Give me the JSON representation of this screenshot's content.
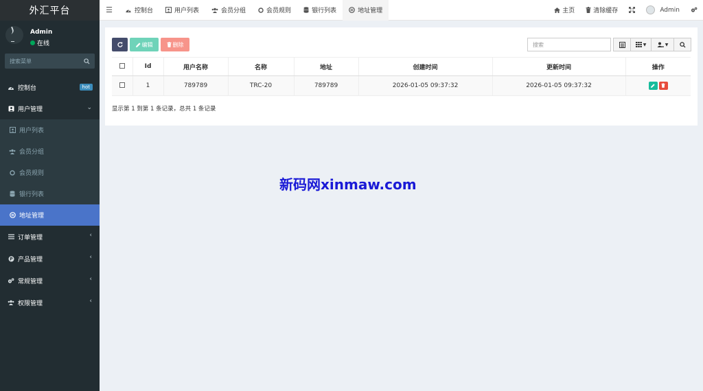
{
  "brand": "外汇平台",
  "user": {
    "name": "Admin",
    "status": "在线"
  },
  "sidebar": {
    "search_placeholder": "搜索菜单",
    "dashboard": {
      "label": "控制台",
      "badge": "hot"
    },
    "user_mgmt": {
      "label": "用户管理"
    },
    "sub_items": [
      {
        "label": "用户列表",
        "icon": "user-list-icon"
      },
      {
        "label": "会员分组",
        "icon": "users-icon"
      },
      {
        "label": "会员规则",
        "icon": "circle-icon"
      },
      {
        "label": "银行列表",
        "icon": "database-icon"
      },
      {
        "label": "地址管理",
        "icon": "address-icon"
      }
    ],
    "lower": [
      {
        "label": "订单管理",
        "icon": "list-icon"
      },
      {
        "label": "产品管理",
        "icon": "product-icon"
      },
      {
        "label": "常规管理",
        "icon": "cogs-icon"
      },
      {
        "label": "权限管理",
        "icon": "group-icon"
      }
    ]
  },
  "navbar": {
    "tabs": [
      {
        "label": "控制台"
      },
      {
        "label": "用户列表"
      },
      {
        "label": "会员分组"
      },
      {
        "label": "会员规则"
      },
      {
        "label": "银行列表"
      },
      {
        "label": "地址管理"
      }
    ],
    "home": "主页",
    "clear_cache": "清除缓存",
    "admin": "Admin"
  },
  "toolbar": {
    "edit": "编辑",
    "delete": "删除",
    "search_placeholder": "搜索"
  },
  "table": {
    "headers": [
      "Id",
      "用户名称",
      "名称",
      "地址",
      "创建时间",
      "更新时间",
      "操作"
    ],
    "rows": [
      {
        "id": "1",
        "username": "789789",
        "name": "TRC-20",
        "address": "789789",
        "created": "2026-01-05 09:37:32",
        "updated": "2026-01-05 09:37:32"
      }
    ]
  },
  "pagination": "显示第 1 到第 1 条记录，总共 1 条记录",
  "watermark": "新码网xinmaw.com",
  "colors": {
    "sidebar_bg": "#222d32",
    "active": "#4a74c9",
    "edit": "#18bc9c",
    "delete": "#e74c3c"
  }
}
